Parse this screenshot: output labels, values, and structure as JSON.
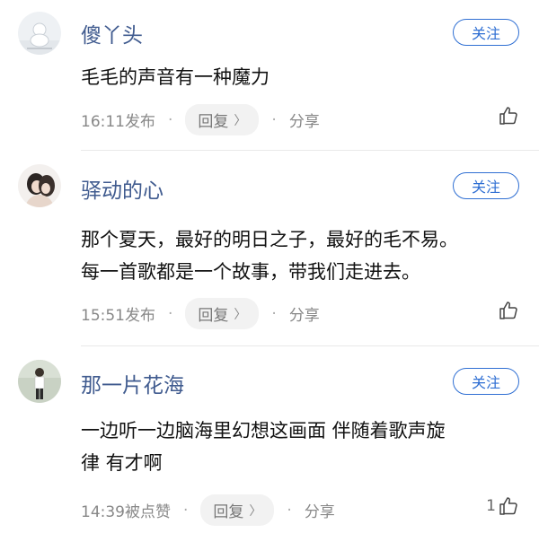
{
  "comments": [
    {
      "username": "傻丫头",
      "follow_label": "关注",
      "content_lines": [
        "毛毛的声音有一种魔力"
      ],
      "time_status": "16:11发布",
      "dot": "·",
      "reply_label": "回复",
      "chevron": "〉",
      "share_label": "分享",
      "like_count": "",
      "icon": "thumbs-up-icon"
    },
    {
      "username": "驿动的心",
      "follow_label": "关注",
      "content_lines": [
        "那个夏天，最好的明日之子，最好的毛不易。",
        "每一首歌都是一个故事，带我们走进去。"
      ],
      "time_status": "15:51发布",
      "dot": "·",
      "reply_label": "回复",
      "chevron": "〉",
      "share_label": "分享",
      "like_count": "",
      "icon": "thumbs-up-icon"
    },
    {
      "username": "那一片花海",
      "follow_label": "关注",
      "content_lines": [
        "一边听一边脑海里幻想这画面  伴随着歌声旋",
        "律   有才啊"
      ],
      "time_status": "14:39被点赞",
      "dot": "·",
      "reply_label": "回复",
      "chevron": "〉",
      "share_label": "分享",
      "like_count": "1",
      "icon": "thumbs-up-icon"
    }
  ],
  "colors": {
    "username": "#405b8f",
    "follow": "#2f6fd3",
    "meta": "#888888",
    "reply_bg": "#f2f2f2"
  }
}
